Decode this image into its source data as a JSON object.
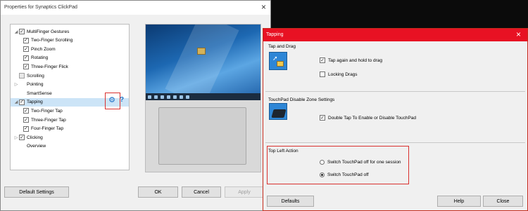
{
  "left_dialog": {
    "title": "Properties for Synaptics ClickPad",
    "close_glyph": "×",
    "tree": [
      {
        "label": "MultiFinger Gestures",
        "checked": true,
        "arrow": "◢",
        "indent": 0,
        "gray": false
      },
      {
        "label": "Two-Finger Scrolling",
        "checked": true,
        "arrow": "",
        "indent": 1,
        "gray": false
      },
      {
        "label": "Pinch Zoom",
        "checked": true,
        "arrow": "",
        "indent": 1,
        "gray": false
      },
      {
        "label": "Rotating",
        "checked": true,
        "arrow": "",
        "indent": 1,
        "gray": false
      },
      {
        "label": "Three-Finger Flick",
        "checked": true,
        "arrow": "",
        "indent": 1,
        "gray": false
      },
      {
        "label": "Scrolling",
        "checked": false,
        "arrow": "",
        "indent": 0,
        "gray": true
      },
      {
        "label": "Pointing",
        "checked": null,
        "arrow": "▷",
        "indent": 0,
        "gray": false
      },
      {
        "label": "SmartSense",
        "checked": null,
        "arrow": "",
        "indent": 0,
        "gray": false
      },
      {
        "label": "Tapping",
        "checked": true,
        "arrow": "◢",
        "indent": 0,
        "gray": false,
        "selected": true
      },
      {
        "label": "Two-Finger Tap",
        "checked": true,
        "arrow": "",
        "indent": 1,
        "gray": false
      },
      {
        "label": "Three-Finger Tap",
        "checked": true,
        "arrow": "",
        "indent": 1,
        "gray": false
      },
      {
        "label": "Four-Finger Tap",
        "checked": true,
        "arrow": "",
        "indent": 1,
        "gray": false
      },
      {
        "label": "Clicking",
        "checked": true,
        "arrow": "▷",
        "indent": 0,
        "gray": false
      },
      {
        "label": "Overview",
        "checked": null,
        "arrow": "",
        "indent": 0,
        "gray": false
      }
    ],
    "gear_icon": "⚙",
    "help_icon": "?",
    "buttons": {
      "default_settings": "Default Settings",
      "ok": "OK",
      "cancel": "Cancel",
      "apply": "Apply"
    }
  },
  "right_dialog": {
    "title": "Tapping",
    "close_glyph": "×",
    "tap_and_drag": {
      "heading": "Tap and Drag",
      "options": [
        {
          "label": "Tap again and hold to drag",
          "checked": true
        },
        {
          "label": "Locking Drags",
          "checked": false
        }
      ]
    },
    "disable_zone": {
      "heading": "TouchPad Disable Zone Settings",
      "options": [
        {
          "label": "Double Tap To Enable or Disable TouchPad",
          "checked": true
        }
      ]
    },
    "top_left_action": {
      "heading": "Top Left Action",
      "options": [
        {
          "label": "Switch TouchPad off for one session",
          "selected": false
        },
        {
          "label": "Switch TouchPad off",
          "selected": true
        }
      ]
    },
    "buttons": {
      "defaults": "Defaults",
      "help": "Help",
      "close": "Close"
    }
  },
  "colors": {
    "accent_red": "#e81123",
    "highlight_box": "#d9302e",
    "selection": "#cce4f7",
    "icon_blue": "#1c6fc4"
  }
}
